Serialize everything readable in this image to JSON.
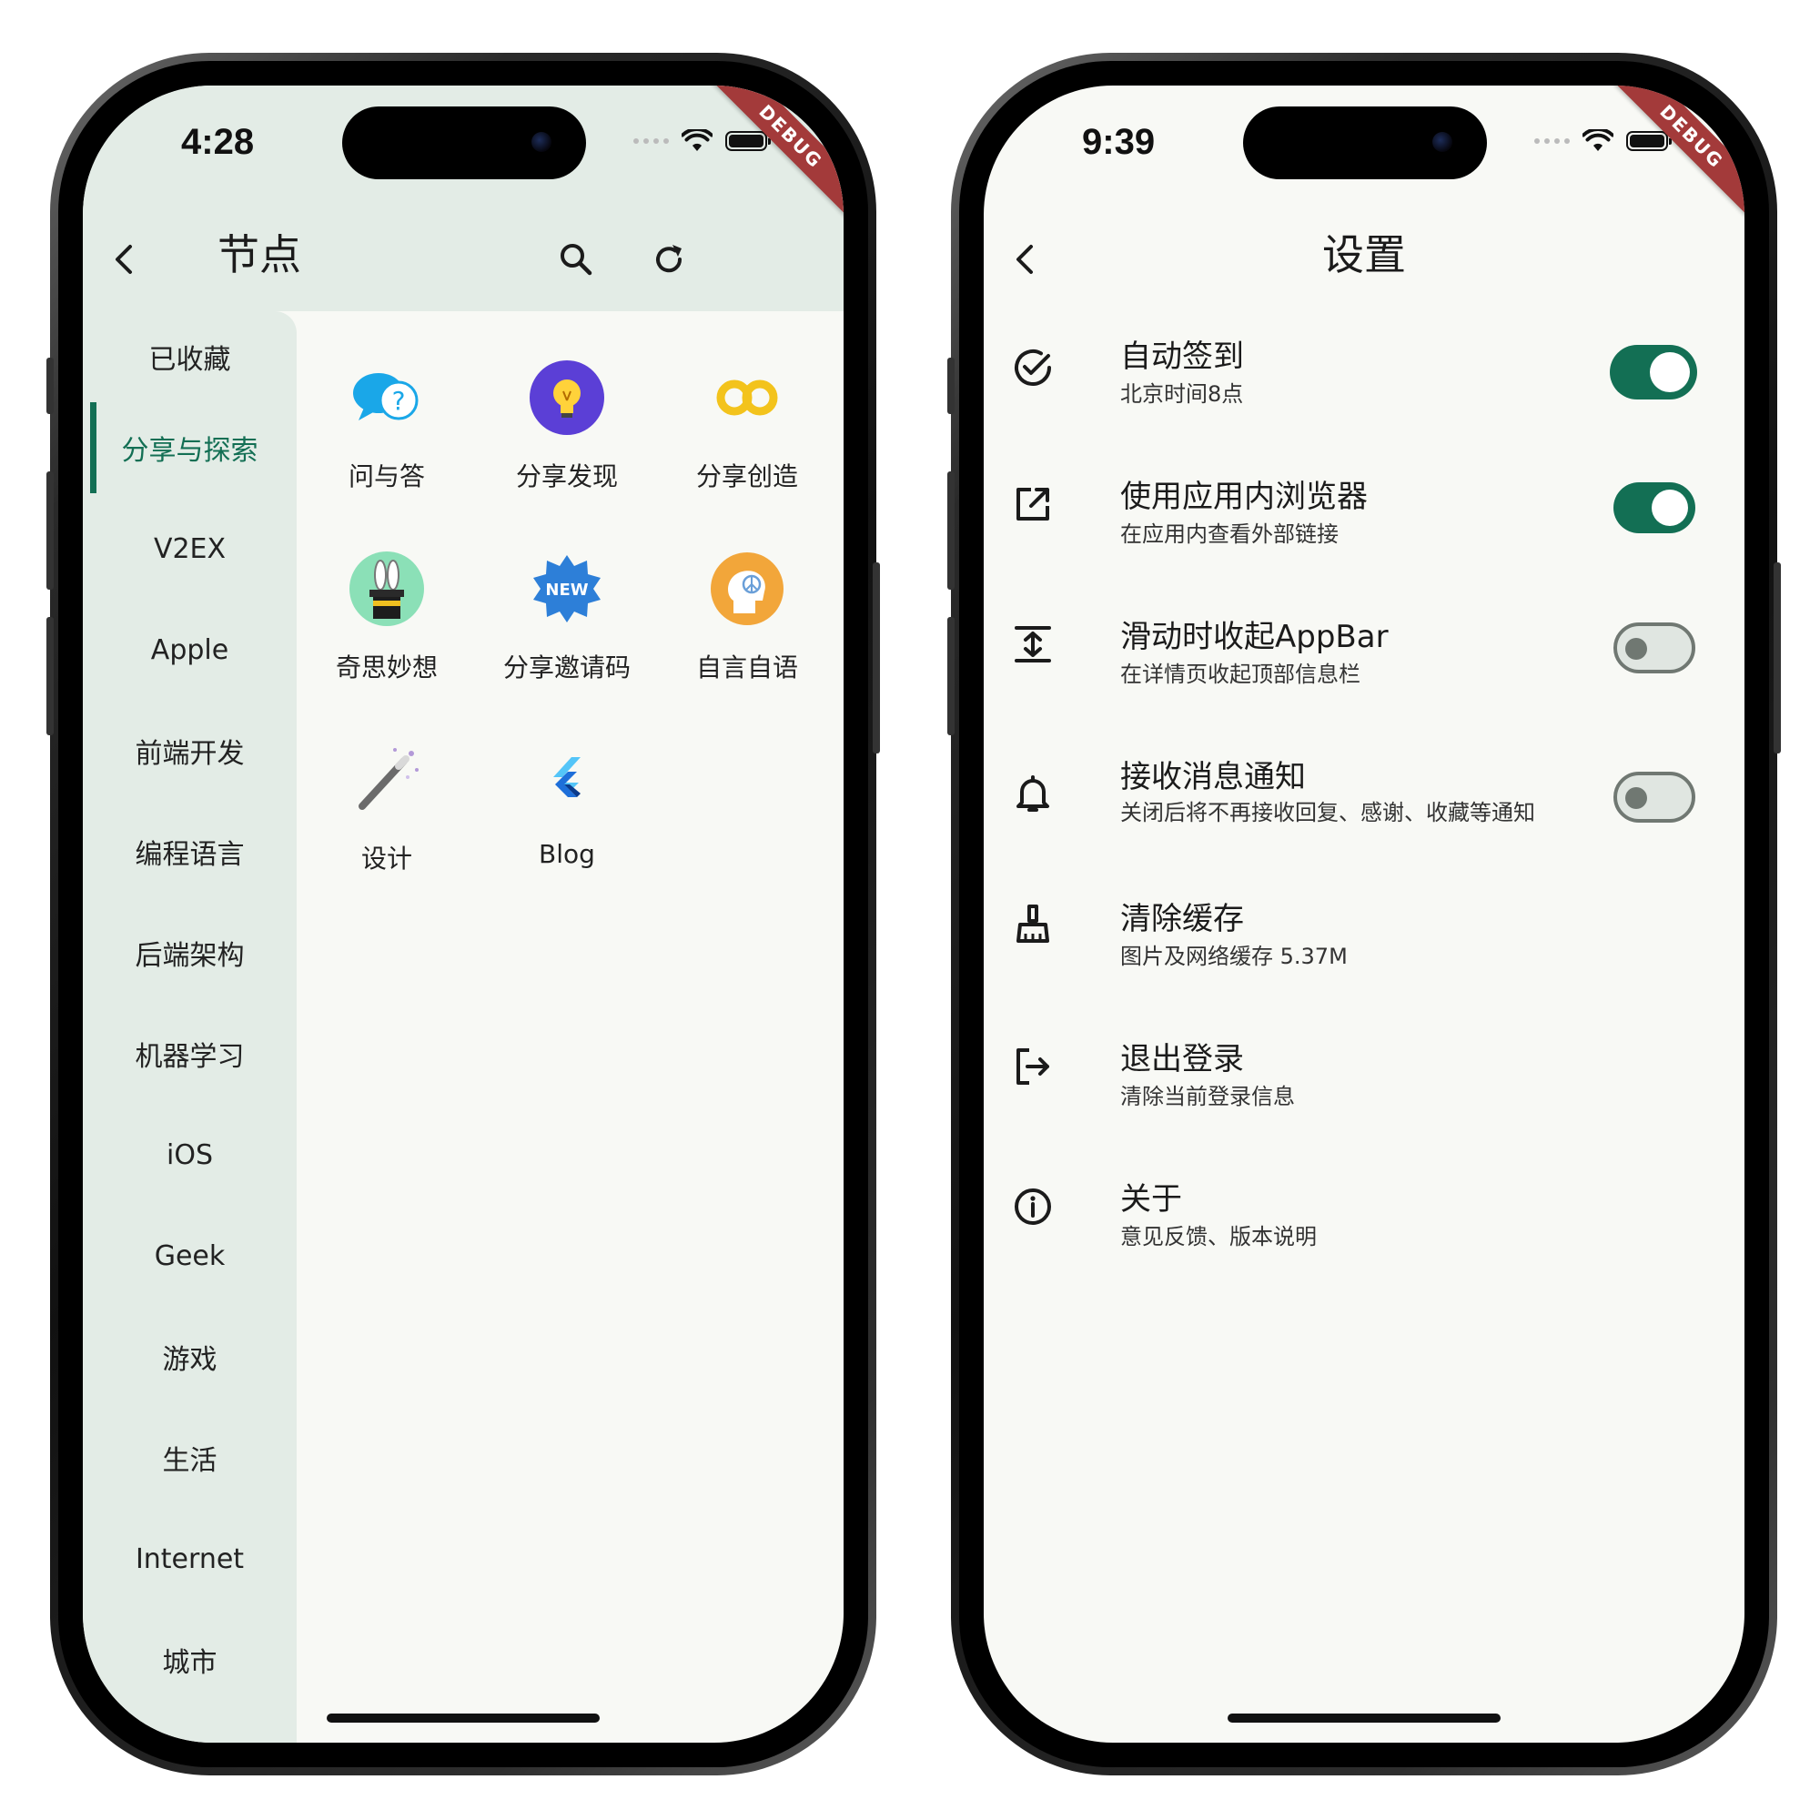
{
  "left": {
    "status_time": "4:28",
    "debug_label": "DEBUG",
    "title": "节点",
    "sidebar": [
      {
        "label": "已收藏"
      },
      {
        "label": "分享与探索"
      },
      {
        "label": "V2EX"
      },
      {
        "label": "Apple"
      },
      {
        "label": "前端开发"
      },
      {
        "label": "编程语言"
      },
      {
        "label": "后端架构"
      },
      {
        "label": "机器学习"
      },
      {
        "label": "iOS"
      },
      {
        "label": "Geek"
      },
      {
        "label": "游戏"
      },
      {
        "label": "生活"
      },
      {
        "label": "Internet"
      },
      {
        "label": "城市"
      }
    ],
    "active_sidebar": "分享与探索",
    "nodes": [
      {
        "label": "问与答",
        "icon": "qna-bubble-icon"
      },
      {
        "label": "分享发现",
        "icon": "lightbulb-icon"
      },
      {
        "label": "分享创造",
        "icon": "infinity-icon"
      },
      {
        "label": "奇思妙想",
        "icon": "magic-hat-icon"
      },
      {
        "label": "分享邀请码",
        "icon": "new-badge-icon"
      },
      {
        "label": "自言自语",
        "icon": "thinking-head-icon"
      },
      {
        "label": "设计",
        "icon": "magic-wand-icon"
      },
      {
        "label": "Blog",
        "icon": "flutter-logo-icon"
      }
    ]
  },
  "right": {
    "status_time": "9:39",
    "debug_label": "DEBUG",
    "title": "设置",
    "settings": [
      {
        "title": "自动签到",
        "subtitle": "北京时间8点",
        "icon": "check-circle-icon",
        "toggle": true
      },
      {
        "title": "使用应用内浏览器",
        "subtitle": "在应用内查看外部链接",
        "icon": "open-external-icon",
        "toggle": true
      },
      {
        "title": "滑动时收起AppBar",
        "subtitle": "在详情页收起顶部信息栏",
        "icon": "vertical-expand-icon",
        "toggle": false
      },
      {
        "title": "接收消息通知",
        "subtitle": "关闭后将不再接收回复、感谢、收藏等通知",
        "icon": "bell-icon",
        "toggle": false
      },
      {
        "title": "清除缓存",
        "subtitle": "图片及网络缓存 5.37M",
        "icon": "broom-icon",
        "toggle": null
      },
      {
        "title": "退出登录",
        "subtitle": "清除当前登录信息",
        "icon": "logout-icon",
        "toggle": null
      },
      {
        "title": "关于",
        "subtitle": "意见反馈、版本说明",
        "icon": "info-icon",
        "toggle": null
      }
    ]
  },
  "colors": {
    "accent": "#136f54",
    "appbar_bg": "#e3ece6",
    "page_bg": "#f8f9f5",
    "debug_ribbon": "#a33a3a"
  }
}
